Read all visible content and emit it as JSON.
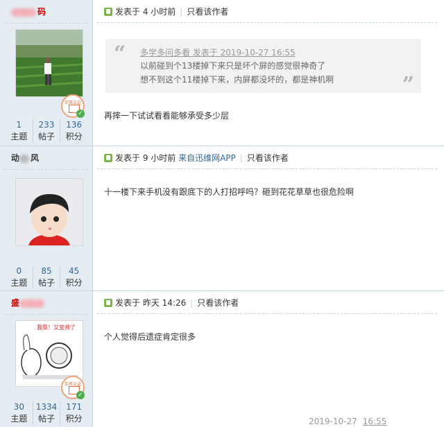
{
  "posts": [
    {
      "username": "码",
      "time": "发表于 4 小时前",
      "only_author": "只看该作者",
      "quote": {
        "header": "多学多问多看 发表于 2019-10-27 16:55",
        "line1": "以前碰到个13楼掉下来只是坏个屏的感觉很神奇了",
        "line2": "想不到这个11楼掉下来，内屏都没坏的，都是神机啊"
      },
      "text": "再摔一下试试看看能够承受多少层",
      "stats": [
        {
          "value": "1",
          "label": "主题"
        },
        {
          "value": "233",
          "label": "帖子"
        },
        {
          "value": "136",
          "label": "积分"
        }
      ],
      "badge": "实名认证"
    },
    {
      "username_a": "动",
      "username_b": "风",
      "time": "发表于 9 小时前",
      "source": "来自迅维网APP",
      "only_author": "只看该作者",
      "text": "十一楼下来手机没有跟底下的人打招呼吗？砸到花花草草也很危险啊",
      "stats": [
        {
          "value": "0",
          "label": "主题"
        },
        {
          "value": "85",
          "label": "帖子"
        },
        {
          "value": "45",
          "label": "积分"
        }
      ]
    },
    {
      "username": "盛",
      "time": "发表于 昨天 14:26",
      "only_author": "只看该作者",
      "avatar_caption": "我靠！又变帅了",
      "text": "个人觉得后遗症肯定很多",
      "stats": [
        {
          "value": "30",
          "label": "主题"
        },
        {
          "value": "1334",
          "label": "帖子"
        },
        {
          "value": "171",
          "label": "积分"
        }
      ],
      "badge": "实名认证"
    }
  ],
  "footer": {
    "date": "2019-10-27",
    "time": "16:55"
  }
}
